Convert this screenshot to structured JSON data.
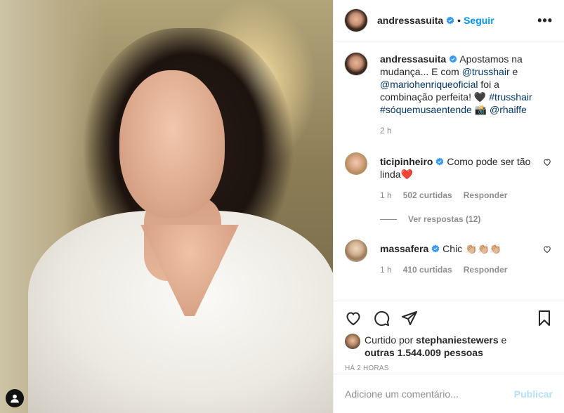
{
  "photo": {
    "alt_icon": "user-tag-icon"
  },
  "header": {
    "username": "andressasuita",
    "separator": "•",
    "follow_label": "Seguir",
    "more_label": "•••"
  },
  "caption": {
    "username": "andressasuita",
    "text_1": " Apostamos na mudança... E com ",
    "mention_1": "@trusshair",
    "text_2": " e ",
    "mention_2": "@mariohenriqueoficial",
    "text_3": " foi a combinação perfeita! 🖤 ",
    "hashtag_1": "#trusshair",
    "text_4": " ",
    "hashtag_2": "#sóquemusaentende",
    "text_5": " 📸 ",
    "mention_3": "@rhaiffe",
    "time": "2 h"
  },
  "comments": [
    {
      "username": "ticipinheiro",
      "text": " Como pode ser tão linda❤️",
      "time": "1 h",
      "likes": "502 curtidas",
      "reply_label": "Responder",
      "view_replies": "Ver respostas (12)"
    },
    {
      "username": "massafera",
      "text": " Chic 👏🏼👏🏼👏🏼",
      "time": "1 h",
      "likes": "410 curtidas",
      "reply_label": "Responder"
    }
  ],
  "likes": {
    "prefix": "Curtido por ",
    "user": "stephaniestewers",
    "middle": " e ",
    "others": "outras 1.544.009 pessoas"
  },
  "post_time": "HÁ 2 HORAS",
  "add_comment": {
    "placeholder": "Adicione um comentário...",
    "publish_label": "Publicar"
  },
  "colors": {
    "accent": "#0095f6",
    "publish_disabled": "#b2dffc",
    "muted": "#8e8e8e",
    "verified": "#3897f0"
  }
}
